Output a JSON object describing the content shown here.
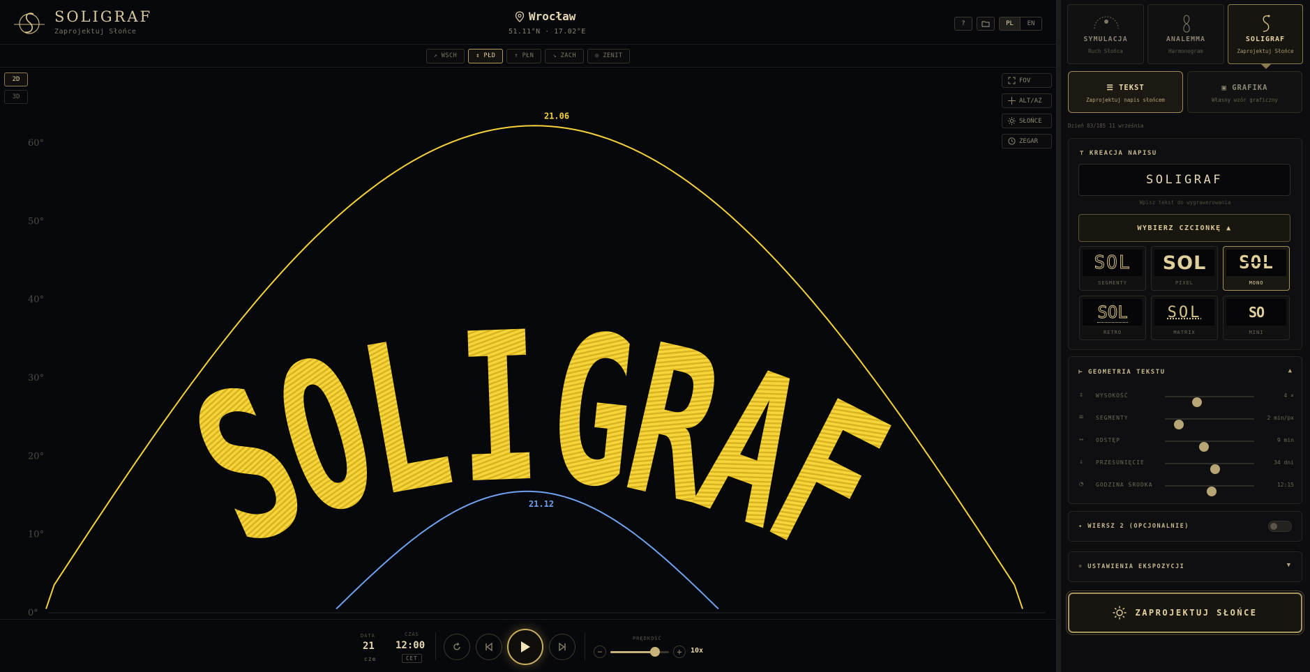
{
  "header": {
    "brand": "SOLIGRAF",
    "brand_sub": "Zaprojektuj Słońce",
    "city": "Wrocław",
    "coords": "51.11°N · 17.02°E",
    "help_label": "?",
    "lang_pl": "PL",
    "lang_en": "EN"
  },
  "directions": [
    {
      "label": "↗ WSCH",
      "active": false
    },
    {
      "label": "↕ PŁD",
      "active": true
    },
    {
      "label": "↑ PŁN",
      "active": false
    },
    {
      "label": "↘ ZACH",
      "active": false
    },
    {
      "label": "◎ ZENIT",
      "active": false
    }
  ],
  "view": {
    "mode_2d": "2D",
    "mode_3d": "3D",
    "active": "2D"
  },
  "tools": {
    "fov": "FOV",
    "altaz": "ALT/AZ",
    "sun": "SŁOŃCE",
    "clock": "ZEGAR"
  },
  "chart_data": {
    "type": "line",
    "y_ticks": [
      "0°",
      "10°",
      "20°",
      "30°",
      "40°",
      "50°",
      "60°"
    ],
    "ylim": [
      0,
      60
    ],
    "series": [
      {
        "name": "21.06",
        "color": "#f5d23c",
        "peak_altitude": 62.2,
        "span": [
          0.035,
          0.775
        ]
      },
      {
        "name": "21.12",
        "color": "#6fa2ee",
        "peak_altitude": 15.5,
        "span": [
          0.255,
          0.545
        ]
      }
    ],
    "text_pattern": "SOLIGRAF",
    "pattern_color": "#f0cc2e"
  },
  "playback": {
    "date_label": "DATA",
    "date_day": "21",
    "date_month": "cze",
    "time_label": "CZAS",
    "time_value": "12:00",
    "tz": "CET",
    "speed_label": "PRĘDKOŚĆ",
    "speed_value": "10x",
    "speed_fraction": 0.76
  },
  "sidebar": {
    "modes": [
      {
        "title": "SYMULACJA",
        "sub": "Ruch Słońca",
        "active": false
      },
      {
        "title": "ANALEMMA",
        "sub": "Harmonogram",
        "active": false
      },
      {
        "title": "SOLIGRAF",
        "sub": "Zaprojektuj Słońce",
        "active": true
      }
    ],
    "subtabs": [
      {
        "title": "TEKST",
        "sub": "Zaprojektuj napis słońcem",
        "active": true
      },
      {
        "title": "GRAFIKA",
        "sub": "Własny wzór graficzny",
        "active": false
      }
    ],
    "day_info": "Dzień 83/185 11 września",
    "text_panel": {
      "title": "KREACJA NAPISU",
      "input_value": "SOLIGRAF",
      "hint": "Wpisz tekst do wygrawerowania",
      "font_button": "WYBIERZ CZCIONKĘ ▲"
    },
    "fonts": [
      {
        "name": "SEGMENTY",
        "active": false
      },
      {
        "name": "PIXEL",
        "active": false
      },
      {
        "name": "MONO",
        "active": true
      },
      {
        "name": "RETRO",
        "active": false
      },
      {
        "name": "MATRIX",
        "active": false
      },
      {
        "name": "MINI",
        "active": false
      }
    ],
    "font_preview": "SOL",
    "geometry": {
      "title": "GEOMETRIA TEKSTU",
      "sliders": [
        {
          "label": "WYSOKOŚĆ",
          "value": "4 ×",
          "fraction": 0.36
        },
        {
          "label": "SEGMENTY",
          "value": "2 min/px",
          "fraction": 0.16
        },
        {
          "label": "ODSTĘP",
          "value": "9 min",
          "fraction": 0.44
        },
        {
          "label": "PRZESUNIĘCIE",
          "value": "34 dni",
          "fraction": 0.56
        },
        {
          "label": "GODZINA ŚRODKA",
          "value": "12:15",
          "fraction": 0.52
        }
      ]
    },
    "row2": {
      "title": "✦ WIERSZ 2 (OPCJONALNIE)",
      "enabled": false
    },
    "exposure": {
      "title": "USTAWIENIA EKSPOZYCJI"
    },
    "design_button": "ZAPROJEKTUJ SŁOŃCE"
  }
}
